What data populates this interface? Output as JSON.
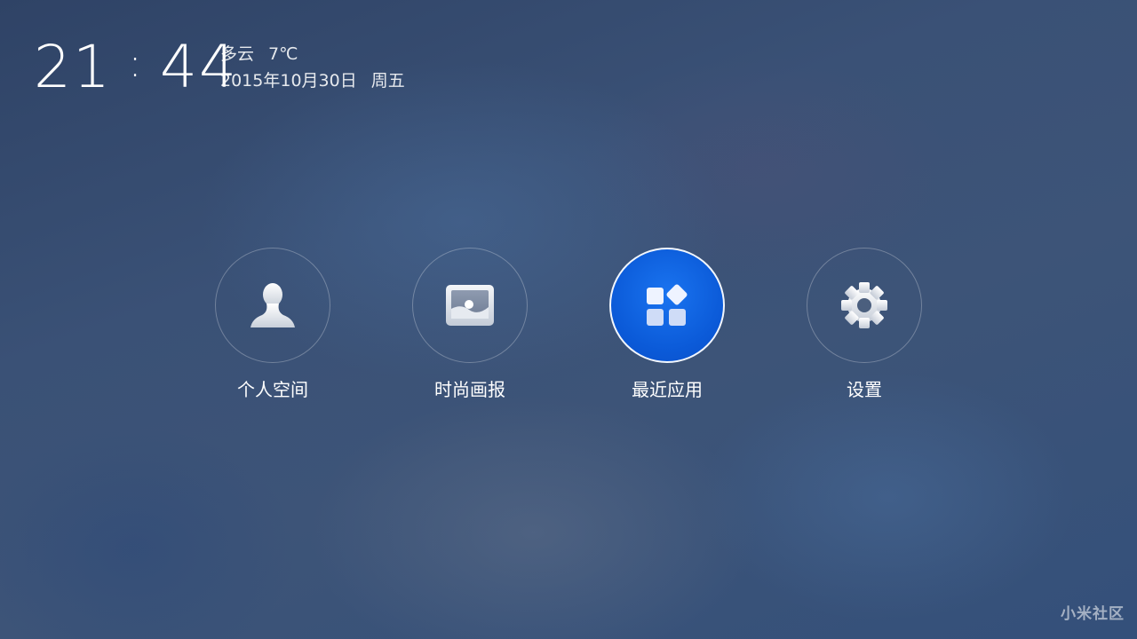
{
  "status": {
    "hours": "21",
    "colon": ":",
    "minutes": "44",
    "weather": "多云",
    "temperature": "7℃",
    "date": "2015年10月30日",
    "weekday": "周五"
  },
  "menu": {
    "items": [
      {
        "label": "个人空间",
        "icon": "person-icon",
        "active": false
      },
      {
        "label": "时尚画报",
        "icon": "picture-frame-icon",
        "active": false
      },
      {
        "label": "最近应用",
        "icon": "app-grid-icon",
        "active": true
      },
      {
        "label": "设置",
        "icon": "gear-icon",
        "active": false
      }
    ]
  },
  "watermark": "小米社区",
  "colors": {
    "background": "#3a5176",
    "active_accent": "#0b5ad8",
    "text": "#ffffff"
  }
}
